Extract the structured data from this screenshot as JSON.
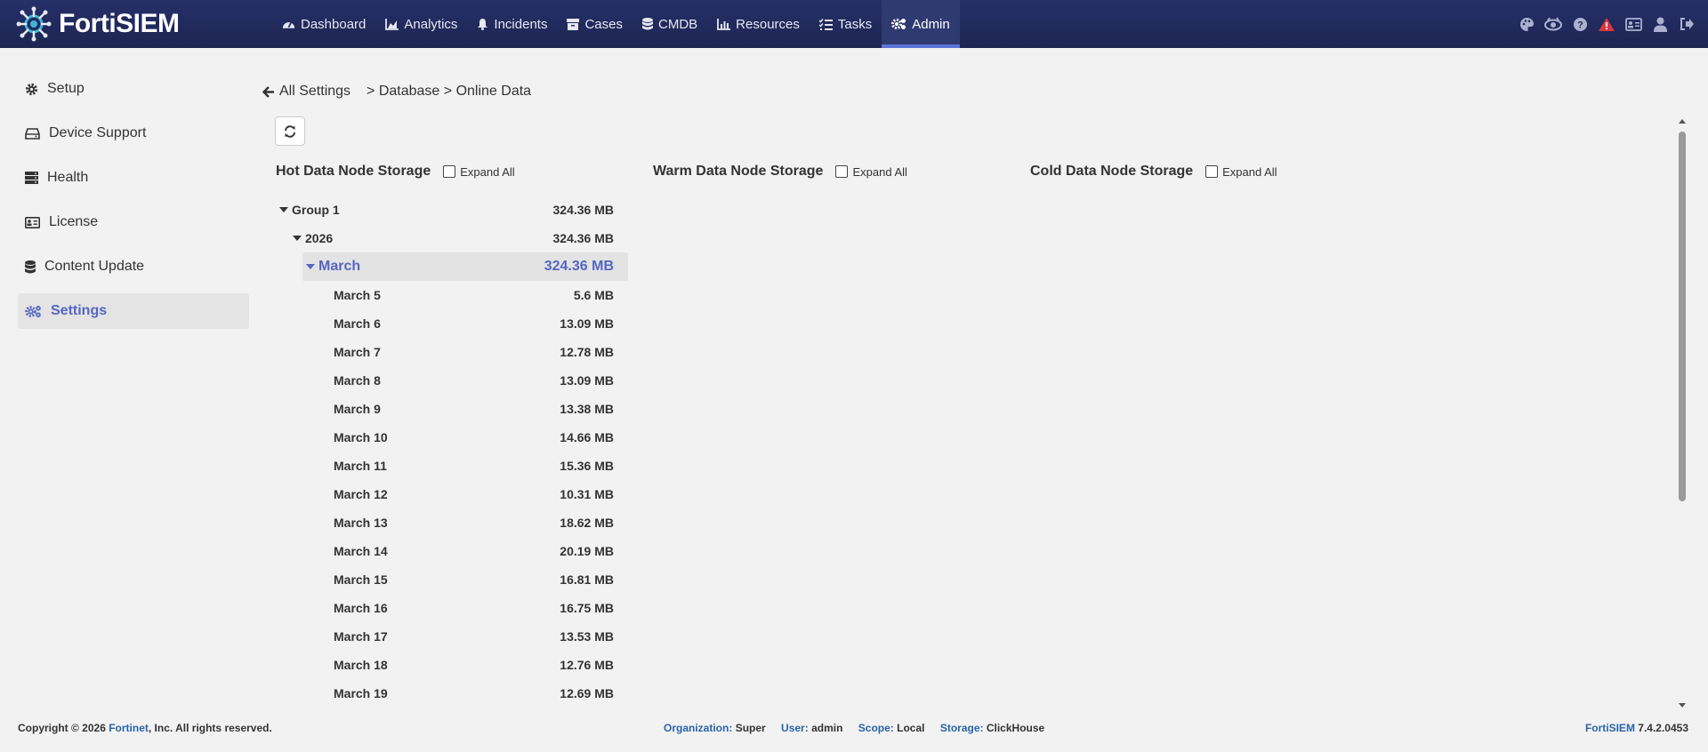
{
  "app": {
    "name": "FortiSIEM"
  },
  "nav": {
    "items": [
      {
        "label": "Dashboard",
        "icon": "gauge-icon"
      },
      {
        "label": "Analytics",
        "icon": "area-chart-icon"
      },
      {
        "label": "Incidents",
        "icon": "bell-icon"
      },
      {
        "label": "Cases",
        "icon": "folder-icon"
      },
      {
        "label": "CMDB",
        "icon": "database-icon"
      },
      {
        "label": "Resources",
        "icon": "bar-chart-icon"
      },
      {
        "label": "Tasks",
        "icon": "task-list-icon"
      },
      {
        "label": "Admin",
        "icon": "gears-icon",
        "active": true
      }
    ],
    "right_icons": [
      "palette-icon",
      "watch-eye-icon",
      "help-icon",
      "alert-icon",
      "id-card-icon",
      "user-icon",
      "logout-icon"
    ]
  },
  "sidebar": {
    "items": [
      {
        "label": "Setup",
        "icon": "gear-icon"
      },
      {
        "label": "Device Support",
        "icon": "hard-drive-icon"
      },
      {
        "label": "Health",
        "icon": "server-icon"
      },
      {
        "label": "License",
        "icon": "id-card-icon"
      },
      {
        "label": "Content Update",
        "icon": "database-icon"
      },
      {
        "label": "Settings",
        "icon": "gears-icon",
        "active": true
      }
    ]
  },
  "breadcrumb": {
    "back": "All Settings",
    "path": "> Database > Online Data"
  },
  "columns": {
    "hot": {
      "title": "Hot Data Node Storage",
      "expand": "Expand All"
    },
    "warm": {
      "title": "Warm Data Node Storage",
      "expand": "Expand All"
    },
    "cold": {
      "title": "Cold Data Node Storage",
      "expand": "Expand All"
    }
  },
  "tree": {
    "group": {
      "label": "Group 1",
      "size": "324.36 MB"
    },
    "year": {
      "label": "2026",
      "size": "324.36 MB"
    },
    "month": {
      "label": "March",
      "size": "324.36 MB"
    },
    "days": [
      {
        "label": "March 5",
        "size": "5.6 MB"
      },
      {
        "label": "March 6",
        "size": "13.09 MB"
      },
      {
        "label": "March 7",
        "size": "12.78 MB"
      },
      {
        "label": "March 8",
        "size": "13.09 MB"
      },
      {
        "label": "March 9",
        "size": "13.38 MB"
      },
      {
        "label": "March 10",
        "size": "14.66 MB"
      },
      {
        "label": "March 11",
        "size": "15.36 MB"
      },
      {
        "label": "March 12",
        "size": "10.31 MB"
      },
      {
        "label": "March 13",
        "size": "18.62 MB"
      },
      {
        "label": "March 14",
        "size": "20.19 MB"
      },
      {
        "label": "March 15",
        "size": "16.81 MB"
      },
      {
        "label": "March 16",
        "size": "16.75 MB"
      },
      {
        "label": "March 17",
        "size": "13.53 MB"
      },
      {
        "label": "March 18",
        "size": "12.76 MB"
      },
      {
        "label": "March 19",
        "size": "12.69 MB"
      }
    ]
  },
  "footer": {
    "copy_prefix": "Copyright © 2026 ",
    "copy_link": "Fortinet",
    "copy_suffix": ", Inc. All rights reserved.",
    "org_label": "Organization:",
    "org_value": "Super",
    "user_label": "User:",
    "user_value": "admin",
    "scope_label": "Scope:",
    "scope_value": "Local",
    "storage_label": "Storage:",
    "storage_value": "ClickHouse",
    "product": "FortiSIEM",
    "version": "7.4.2.0453"
  },
  "colors": {
    "nav_bg": "#222a55",
    "accent": "#5566c3",
    "link": "#2a64a8",
    "alert": "#d9363e"
  }
}
